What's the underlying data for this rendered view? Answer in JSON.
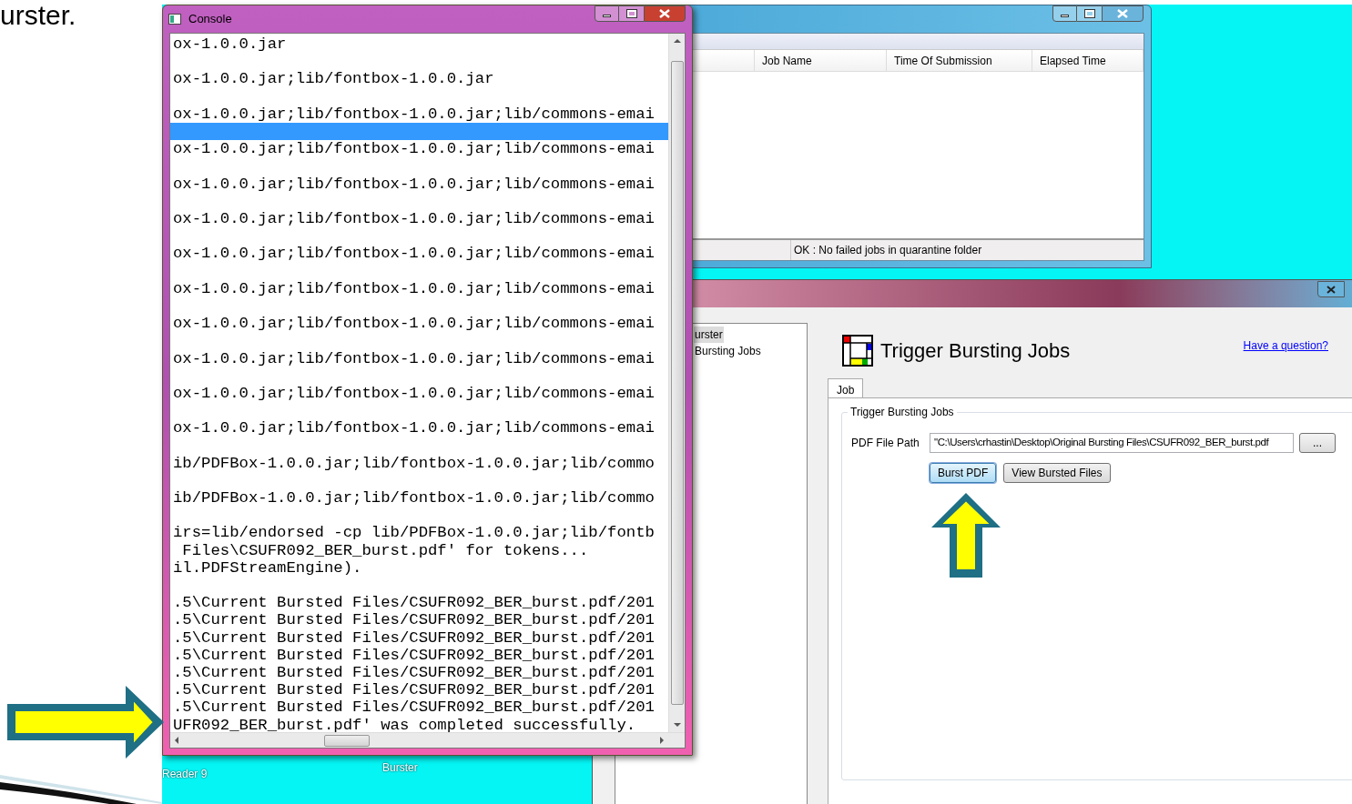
{
  "slide_title": "urster.",
  "desktop_icons": [
    {
      "label": "Reader 9"
    },
    {
      "label": "Burster"
    }
  ],
  "jobs_window": {
    "columns": [
      "Job Name",
      "Time Of Submission",
      "Elapsed Time"
    ],
    "status": "OK : No failed jobs in quarantine folder"
  },
  "main_window": {
    "tree": [
      {
        "label": "urster",
        "selected": true
      },
      {
        "label": "Bursting Jobs",
        "selected": false
      }
    ],
    "title": "Trigger Bursting Jobs",
    "help_link": "Have a question?",
    "tabs": [
      {
        "label": "Job",
        "selected": true
      }
    ],
    "group_title": "Trigger Bursting Jobs",
    "field_label": "PDF File Path",
    "field_value": "\"C:\\Users\\crhastin\\Desktop\\Original Bursting Files\\CSUFR092_BER_burst.pdf",
    "browse_button": "...",
    "buttons": [
      {
        "label": "Burst PDF",
        "focused": true
      },
      {
        "label": "View Bursted Files",
        "focused": false
      }
    ]
  },
  "console": {
    "title": "Console",
    "blocks": [
      {
        "lines": [
          "ox-1.0.0.jar"
        ],
        "selected": false
      },
      {
        "lines": [
          "ox-1.0.0.jar;lib/fontbox-1.0.0.jar"
        ],
        "selected": false
      },
      {
        "lines": [
          "ox-1.0.0.jar;lib/fontbox-1.0.0.jar;lib/commons-emai"
        ],
        "selected": true
      },
      {
        "lines": [
          "ox-1.0.0.jar;lib/fontbox-1.0.0.jar;lib/commons-emai"
        ],
        "selected": false
      },
      {
        "lines": [
          "ox-1.0.0.jar;lib/fontbox-1.0.0.jar;lib/commons-emai"
        ],
        "selected": false
      },
      {
        "lines": [
          "ox-1.0.0.jar;lib/fontbox-1.0.0.jar;lib/commons-emai"
        ],
        "selected": false
      },
      {
        "lines": [
          "ox-1.0.0.jar;lib/fontbox-1.0.0.jar;lib/commons-emai"
        ],
        "selected": false
      },
      {
        "lines": [
          "ox-1.0.0.jar;lib/fontbox-1.0.0.jar;lib/commons-emai"
        ],
        "selected": false
      },
      {
        "lines": [
          "ox-1.0.0.jar;lib/fontbox-1.0.0.jar;lib/commons-emai"
        ],
        "selected": false
      },
      {
        "lines": [
          "ox-1.0.0.jar;lib/fontbox-1.0.0.jar;lib/commons-emai"
        ],
        "selected": false
      },
      {
        "lines": [
          "ox-1.0.0.jar;lib/fontbox-1.0.0.jar;lib/commons-emai"
        ],
        "selected": false
      },
      {
        "lines": [
          "ox-1.0.0.jar;lib/fontbox-1.0.0.jar;lib/commons-emai"
        ],
        "selected": false
      },
      {
        "lines": [
          "ib/PDFBox-1.0.0.jar;lib/fontbox-1.0.0.jar;lib/commo"
        ],
        "selected": false
      },
      {
        "lines": [
          "ib/PDFBox-1.0.0.jar;lib/fontbox-1.0.0.jar;lib/commo"
        ],
        "selected": false
      },
      {
        "lines": [
          "irs=lib/endorsed -cp lib/PDFBox-1.0.0.jar;lib/fontb",
          " Files\\CSUFR092_BER_burst.pdf' for tokens...",
          "il.PDFStreamEngine)."
        ],
        "selected": false
      },
      {
        "lines": [
          ".5\\Current Bursted Files/CSUFR092_BER_burst.pdf/201",
          ".5\\Current Bursted Files/CSUFR092_BER_burst.pdf/201",
          ".5\\Current Bursted Files/CSUFR092_BER_burst.pdf/201",
          ".5\\Current Bursted Files/CSUFR092_BER_burst.pdf/201",
          ".5\\Current Bursted Files/CSUFR092_BER_burst.pdf/201",
          ".5\\Current Bursted Files/CSUFR092_BER_burst.pdf/201",
          ".5\\Current Bursted Files/CSUFR092_BER_burst.pdf/201",
          "UFR092_BER_burst.pdf' was completed successfully."
        ],
        "selected": false
      }
    ]
  }
}
